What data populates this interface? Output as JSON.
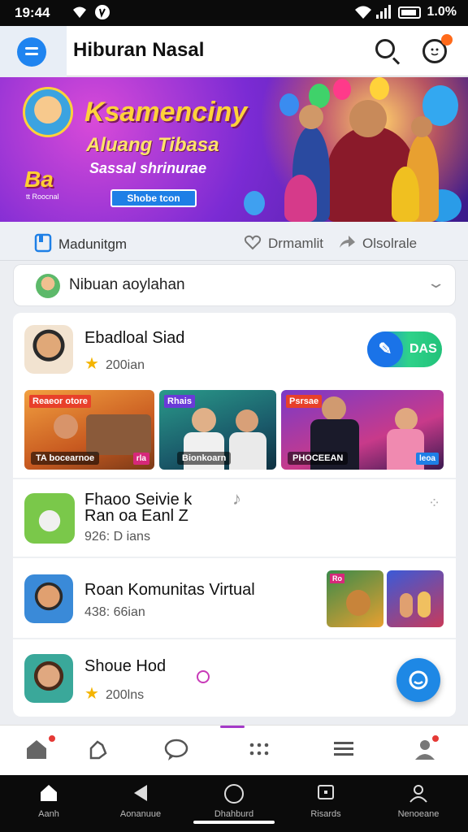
{
  "status_bar": {
    "time": "19:44",
    "battery": "1.0%"
  },
  "app_bar": {
    "title": "Hiburan Nasal"
  },
  "banner": {
    "headline": "Ksamenciny",
    "subline": "Aluang Tibasa",
    "tagline": "Sassal shrinurae",
    "button": "Shobe tcon",
    "logo": "Ba",
    "logo_sub": "tt Roocnal"
  },
  "tabs": [
    {
      "label": "Madunitgm",
      "icon": "bookmark-icon"
    },
    {
      "label": "Drmamlit",
      "icon": "heart-icon"
    },
    {
      "label": "Olsolrale",
      "icon": "share-icon"
    }
  ],
  "dropdown": {
    "label": "Nibuan aoylahan"
  },
  "rows": [
    {
      "title": "Ebadloal Siad",
      "meta": "200ian",
      "has_star": true,
      "action": "DAS"
    },
    {
      "title": "Fhaoo Seivie k\nRan oa Eanl Z",
      "meta": "926: D ians"
    },
    {
      "title": "Roan Komunitas Virtual",
      "meta": "438: 66ian"
    },
    {
      "title": "Shoue Hod",
      "meta": "200lns",
      "has_star": true
    }
  ],
  "thumbnails": [
    {
      "tag": "Reaeor otore",
      "caption": "TA bocearnoe",
      "badge": "rla"
    },
    {
      "tag": "Rhais",
      "caption": "Bionkoarn"
    },
    {
      "tag": "Psrsae",
      "caption": "PHOCEEAN",
      "badge": "leoa"
    }
  ],
  "bottom_nav": [
    {
      "icon": "home-icon"
    },
    {
      "icon": "hand-icon"
    },
    {
      "icon": "chat-icon"
    },
    {
      "icon": "dots-icon"
    },
    {
      "icon": "menu-icon"
    },
    {
      "icon": "profile-icon"
    }
  ],
  "system_nav": [
    {
      "label": "Aanh",
      "icon": "home-icon"
    },
    {
      "label": "Aonanuue",
      "icon": "back-icon"
    },
    {
      "label": "Dhahburd",
      "icon": "circle-icon"
    },
    {
      "label": "Risards",
      "icon": "recent-icon"
    },
    {
      "label": "Nenoeane",
      "icon": "profile-icon"
    }
  ],
  "colors": {
    "accent": "#1f84f0",
    "banner_yellow": "#ffd23a",
    "pill_green": "#2ed28a",
    "star": "#f4b400"
  }
}
